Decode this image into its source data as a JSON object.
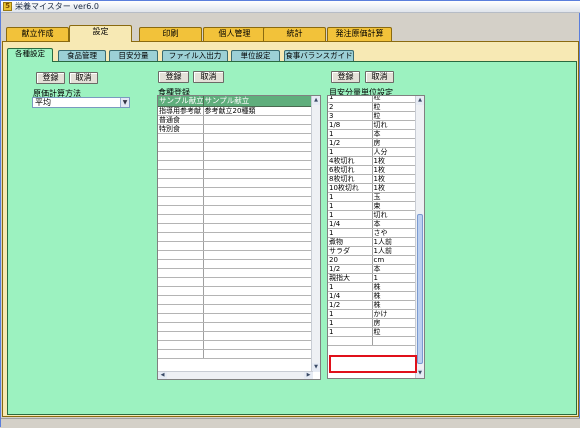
{
  "window": {
    "title": "栄養マイスター ver6.0",
    "app_icon_glyph": "5"
  },
  "main_tabs": [
    {
      "label": "献立作成"
    },
    {
      "label": "設定"
    },
    {
      "label": "印刷"
    },
    {
      "label": "個人管理"
    },
    {
      "label": "統計"
    },
    {
      "label": "発注原価計算"
    }
  ],
  "sub_tabs": [
    {
      "label": "各種設定"
    },
    {
      "label": "食品管理"
    },
    {
      "label": "目安分量"
    },
    {
      "label": "ファイル入出力"
    },
    {
      "label": "単位設定"
    },
    {
      "label": "食事バランスガイド"
    }
  ],
  "cost_section": {
    "register_label": "登録",
    "cancel_label": "取消",
    "method_label": "原価計算方法",
    "method_value": "平均"
  },
  "meal_section": {
    "register_label": "登録",
    "cancel_label": "取消",
    "title": "食種登録",
    "columns": [
      "サンプル献立",
      "サンプル献立"
    ],
    "rows": [
      [
        "指導用参考献",
        "参考献立20種類"
      ],
      [
        "普通食",
        ""
      ],
      [
        "特別食",
        ""
      ]
    ]
  },
  "unit_section": {
    "register_label": "登録",
    "cancel_label": "取消",
    "title": "目安分量単位設定",
    "rows": [
      [
        "1",
        "粒"
      ],
      [
        "2",
        "粒"
      ],
      [
        "3",
        "粒"
      ],
      [
        "1/8",
        "切れ"
      ],
      [
        "1",
        "本"
      ],
      [
        "1/2",
        "房"
      ],
      [
        "1",
        "人分"
      ],
      [
        "4枚切れ",
        "1枚"
      ],
      [
        "6枚切れ",
        "1枚"
      ],
      [
        "8枚切れ",
        "1枚"
      ],
      [
        "10枚切れ",
        "1枚"
      ],
      [
        "1",
        "玉"
      ],
      [
        "1",
        "束"
      ],
      [
        "1",
        "切れ"
      ],
      [
        "1/4",
        "本"
      ],
      [
        "1",
        "さや"
      ],
      [
        "煮物",
        "1人前"
      ],
      [
        "サラダ",
        "1人前"
      ],
      [
        "20",
        "cm"
      ],
      [
        "1/2",
        "本"
      ],
      [
        "親指大",
        "1"
      ],
      [
        "1",
        "株"
      ],
      [
        "1/4",
        "株"
      ],
      [
        "1/2",
        "株"
      ],
      [
        "1",
        "かけ"
      ],
      [
        "1",
        "房"
      ],
      [
        "1",
        "粒"
      ],
      [
        "",
        ""
      ]
    ]
  },
  "colors": {
    "main_panel": "#f7e9b4",
    "main_tab": "#f2c23a",
    "sub_panel": "#9cf2c0",
    "sub_tab": "#9cd0d6",
    "grid_header": "#5fae7c",
    "highlight_box": "#e0101a"
  },
  "icons": {
    "dropdown": "▼",
    "scroll_up": "▲",
    "scroll_down": "▼",
    "scroll_left": "◀",
    "scroll_right": "▶"
  }
}
